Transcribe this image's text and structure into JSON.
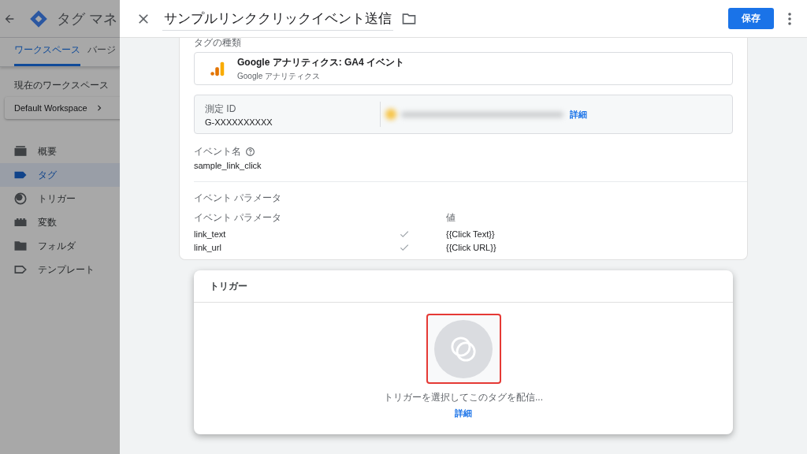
{
  "sidebar": {
    "app_title": "タグ マネ",
    "tabs": [
      {
        "label": "ワークスペース",
        "selected": true
      },
      {
        "label": "バージ",
        "selected": false
      }
    ],
    "workspace_label": "現在のワークスペース",
    "workspace": "Default Workspace",
    "nav_items": [
      {
        "label": "概要",
        "kind": "overview",
        "selected": false
      },
      {
        "label": "タグ",
        "kind": "tag",
        "selected": true
      },
      {
        "label": "トリガー",
        "kind": "trigger",
        "selected": false
      },
      {
        "label": "変数",
        "kind": "variable",
        "selected": false
      },
      {
        "label": "フォルダ",
        "kind": "folder",
        "selected": false
      },
      {
        "label": "テンプレート",
        "kind": "template",
        "selected": false
      }
    ]
  },
  "editor": {
    "title": "サンプルリンククリックイベント送信",
    "save_button": "保存",
    "tag_type_label": "タグの種類",
    "tag_type": {
      "name": "Google アナリティクス: GA4 イベント",
      "vendor": "Google アナリティクス"
    },
    "measurement_id": {
      "label": "測定 ID",
      "value": "G-XXXXXXXXXX",
      "link": "詳細"
    },
    "event_name": {
      "label": "イベント名",
      "value": "sample_link_click"
    },
    "event_parameters": {
      "title": "イベント パラメータ",
      "columns": [
        "イベント パラメータ",
        "値"
      ],
      "rows": [
        {
          "name": "link_text",
          "checked": true,
          "value": "{{Click Text}}"
        },
        {
          "name": "link_url",
          "checked": true,
          "value": "{{Click URL}}"
        }
      ]
    },
    "trigger": {
      "title": "トリガー",
      "hint": "トリガーを選択してこのタグを配信...",
      "link": "詳細",
      "highlighted": true
    }
  }
}
